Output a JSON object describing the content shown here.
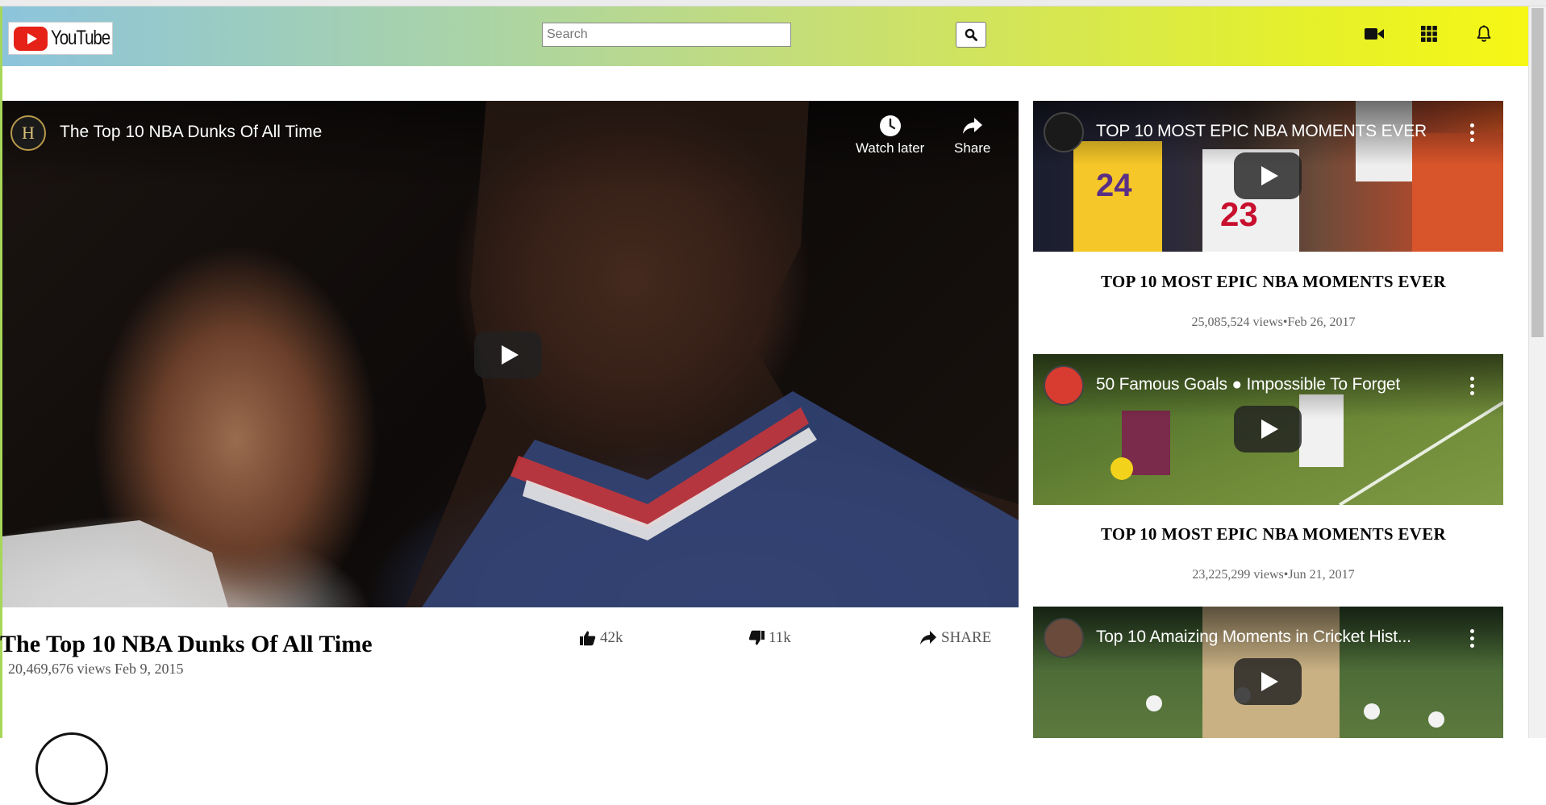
{
  "header": {
    "logo_text": "YouTube",
    "search_placeholder": "Search",
    "icons": [
      "video-camera-icon",
      "apps-grid-icon",
      "bell-icon"
    ]
  },
  "main_video": {
    "embed_title": "The Top 10 NBA Dunks Of All Time",
    "channel_initial": "H",
    "watch_later_label": "Watch later",
    "share_overlay_label": "Share",
    "title": "The Top 10 NBA Dunks Of All Time",
    "views": "20,469,676 views",
    "date": "Feb 9, 2015",
    "likes": "42k",
    "dislikes": "11k",
    "share_label": "SHARE"
  },
  "sidebar": {
    "items": [
      {
        "embed_title": "TOP 10 MOST EPIC NBA MOMENTS EVER",
        "title": "TOP 10 MOST EPIC NBA MOMENTS EVER",
        "views": "25,085,524 views",
        "date": "Feb 26, 2017"
      },
      {
        "embed_title": "50 Famous Goals ● Impossible To Forget",
        "title": "TOP 10 MOST EPIC NBA MOMENTS EVER",
        "views": "23,225,299 views",
        "date": "Jun 21, 2017"
      },
      {
        "embed_title": "Top 10 Amaizing Moments in Cricket Hist..."
      }
    ]
  },
  "colors": {
    "youtube_red": "#e62117",
    "header_gradient_start": "#8cc4dc",
    "header_gradient_end": "#f6f714"
  }
}
